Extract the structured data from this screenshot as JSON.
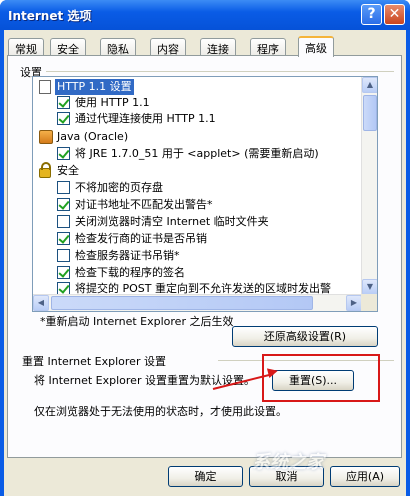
{
  "window": {
    "title": "Internet 选项"
  },
  "tabs": [
    "常规",
    "安全",
    "隐私",
    "内容",
    "连接",
    "程序",
    "高级"
  ],
  "active_tab": "高级",
  "settings": {
    "group_label": "设置",
    "items": [
      {
        "kind": "header",
        "icon": "document-icon",
        "label": "HTTP 1.1 设置",
        "selected": true
      },
      {
        "kind": "checkbox",
        "checked": true,
        "label": "使用 HTTP 1.1"
      },
      {
        "kind": "checkbox",
        "checked": true,
        "label": "通过代理连接使用 HTTP 1.1"
      },
      {
        "kind": "header",
        "icon": "java-icon",
        "label": "Java (Oracle)"
      },
      {
        "kind": "checkbox",
        "checked": true,
        "label": "将 JRE 1.7.0_51 用于 <applet> (需要重新启动)"
      },
      {
        "kind": "header",
        "icon": "lock-icon",
        "label": "安全"
      },
      {
        "kind": "checkbox",
        "checked": false,
        "label": "不将加密的页存盘"
      },
      {
        "kind": "checkbox",
        "checked": true,
        "label": "对证书地址不匹配发出警告*"
      },
      {
        "kind": "checkbox",
        "checked": false,
        "label": "关闭浏览器时清空 Internet 临时文件夹"
      },
      {
        "kind": "checkbox",
        "checked": true,
        "label": "检查发行商的证书是否吊销"
      },
      {
        "kind": "checkbox",
        "checked": false,
        "label": "检查服务器证书吊销*"
      },
      {
        "kind": "checkbox",
        "checked": true,
        "label": "检查下载的程序的签名"
      },
      {
        "kind": "checkbox",
        "checked": true,
        "label": "将提交的 POST 重定向到不允许发送的区域时发出警"
      }
    ],
    "restart_note": "*重新启动 Internet Explorer 之后生效",
    "restore_button": "还原高级设置(R)"
  },
  "reset": {
    "group_label": "重置 Internet Explorer 设置",
    "description": "将 Internet Explorer 设置重置为默认设置。",
    "button": "重置(S)...",
    "note": "仅在浏览器处于无法使用的状态时，才使用此设置。"
  },
  "footer": {
    "ok": "确定",
    "cancel": "取消",
    "apply": "应用(A)"
  },
  "colors": {
    "title_bar": "#0a5ce6",
    "highlight": "#d81818",
    "selection": "#316ac5"
  }
}
